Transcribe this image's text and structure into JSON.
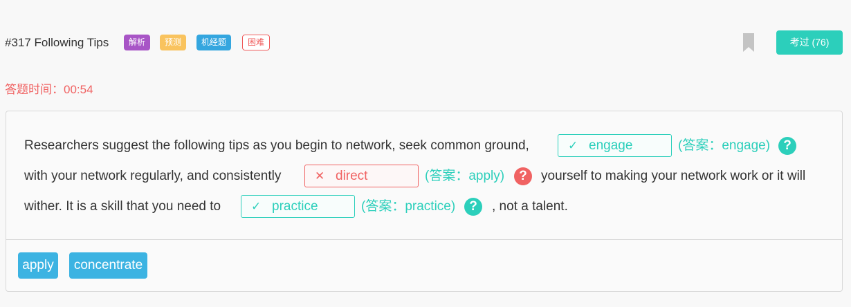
{
  "header": {
    "title": "#317 Following Tips",
    "tags": [
      "解析",
      "预测",
      "机经题",
      "困难"
    ],
    "exam_button": "考过 (76)"
  },
  "timer": "答题时间：00:54",
  "question": {
    "line1_text1": "Researchers suggest the following tips as you begin to network, seek common ground,",
    "blank1": {
      "mark": "✓",
      "value": "engage",
      "answer": "(答案：engage)",
      "status": "correct"
    },
    "line2_text1": "with your network regularly, and consistently",
    "blank2": {
      "mark": "✕",
      "value": "direct",
      "answer": "(答案：apply)",
      "status": "incorrect"
    },
    "line2_text2": "yourself to making your network work or it will",
    "line3_text1": "wither. It is a skill that you need to",
    "blank3": {
      "mark": "✓",
      "value": "practice",
      "answer": "(答案：practice)",
      "status": "correct"
    },
    "line3_text2": ", not a talent.",
    "help_glyph": "?"
  },
  "options": [
    "apply",
    "concentrate"
  ],
  "colors": {
    "accent": "#2ccfbb",
    "error": "#f06262",
    "option": "#3cb3e2",
    "tag_analysis": "#a855c6",
    "tag_predict": "#f9c35e",
    "tag_machine": "#34a6df"
  }
}
